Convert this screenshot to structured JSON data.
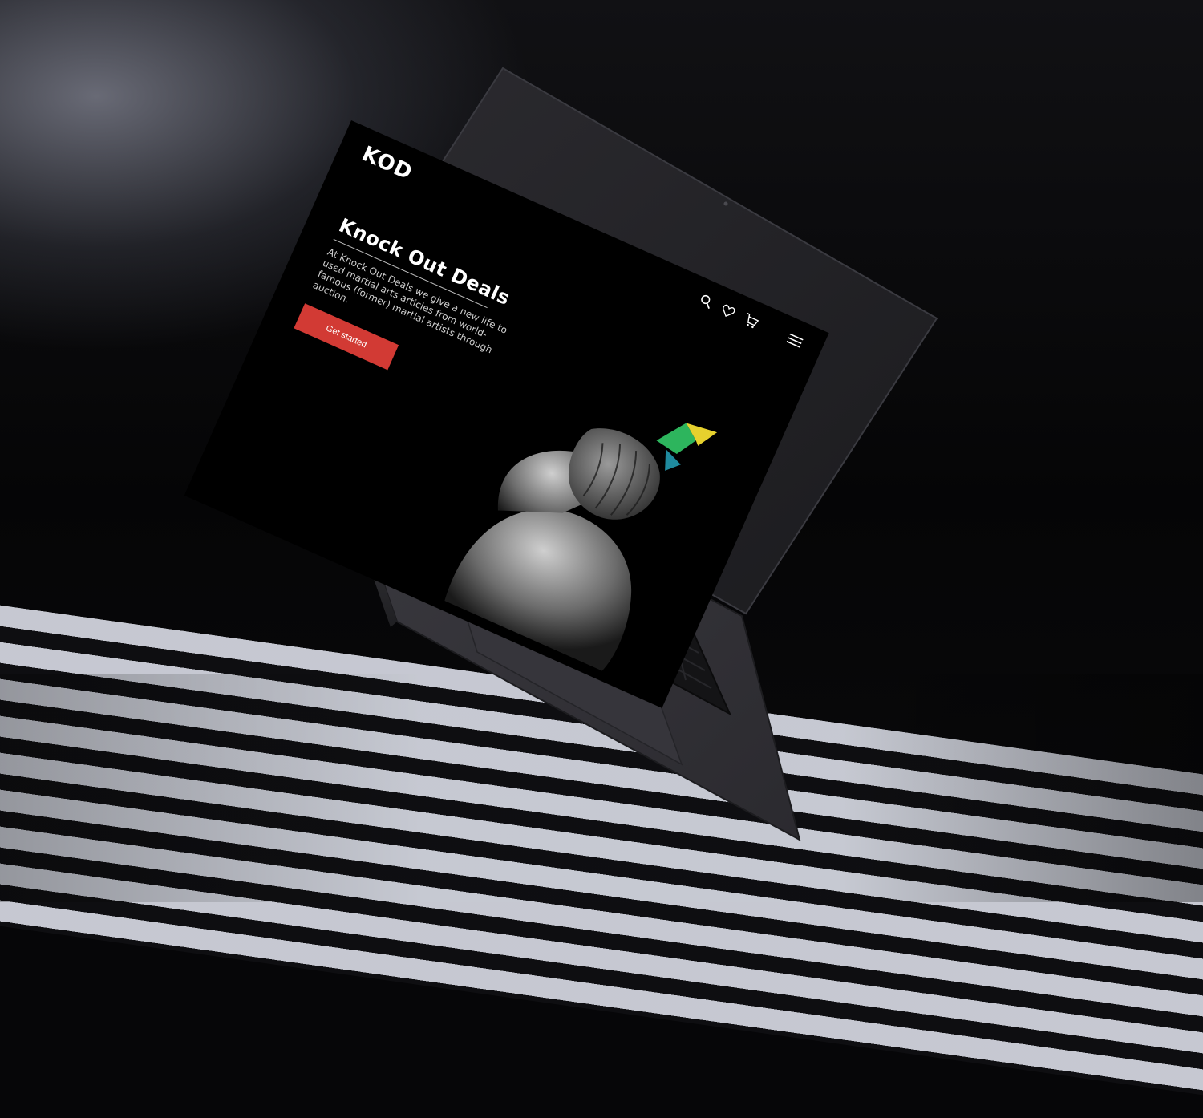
{
  "site": {
    "logo_text": "KOD"
  },
  "nav": {
    "icons": [
      "search-icon",
      "heart-icon",
      "cart-icon",
      "menu-icon"
    ]
  },
  "hero": {
    "title": "Knock Out Deals",
    "description": "At Knock Out Deals we give a new life to used martial arts articles from world-famous (former) martial artists through auction.",
    "cta_label": "Get started"
  },
  "colors": {
    "accent": "#d23a34",
    "screen_bg": "#000000",
    "text_primary": "#ffffff",
    "text_secondary": "#cfcfcf"
  }
}
